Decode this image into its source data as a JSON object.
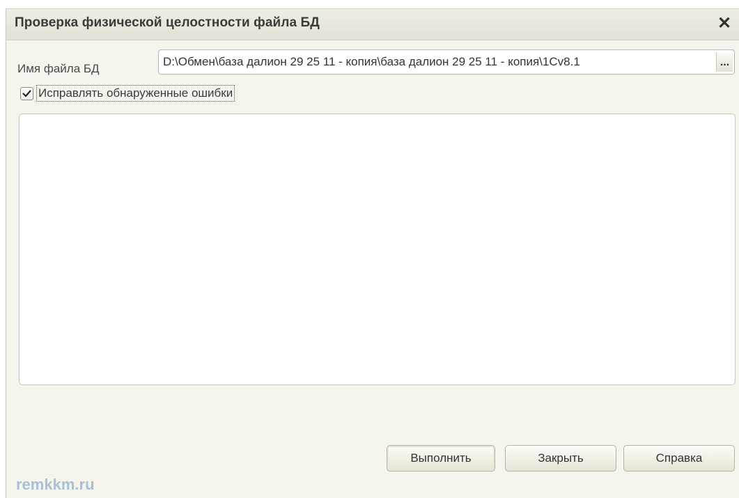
{
  "window": {
    "title": "Проверка физической целостности файла БД",
    "close_glyph": "✕"
  },
  "file": {
    "label": "Имя файла БД",
    "path": "D:\\Обмен\\база далион 29 25 11 - копия\\база далион 29 25 11 - копия\\1Cv8.1",
    "browse_label": "..."
  },
  "fix_errors": {
    "label": "Исправлять обнаруженные ошибки",
    "checked": true
  },
  "buttons": {
    "run": "Выполнить",
    "close": "Закрыть",
    "help": "Справка"
  },
  "watermark": "remkkm.ru"
}
